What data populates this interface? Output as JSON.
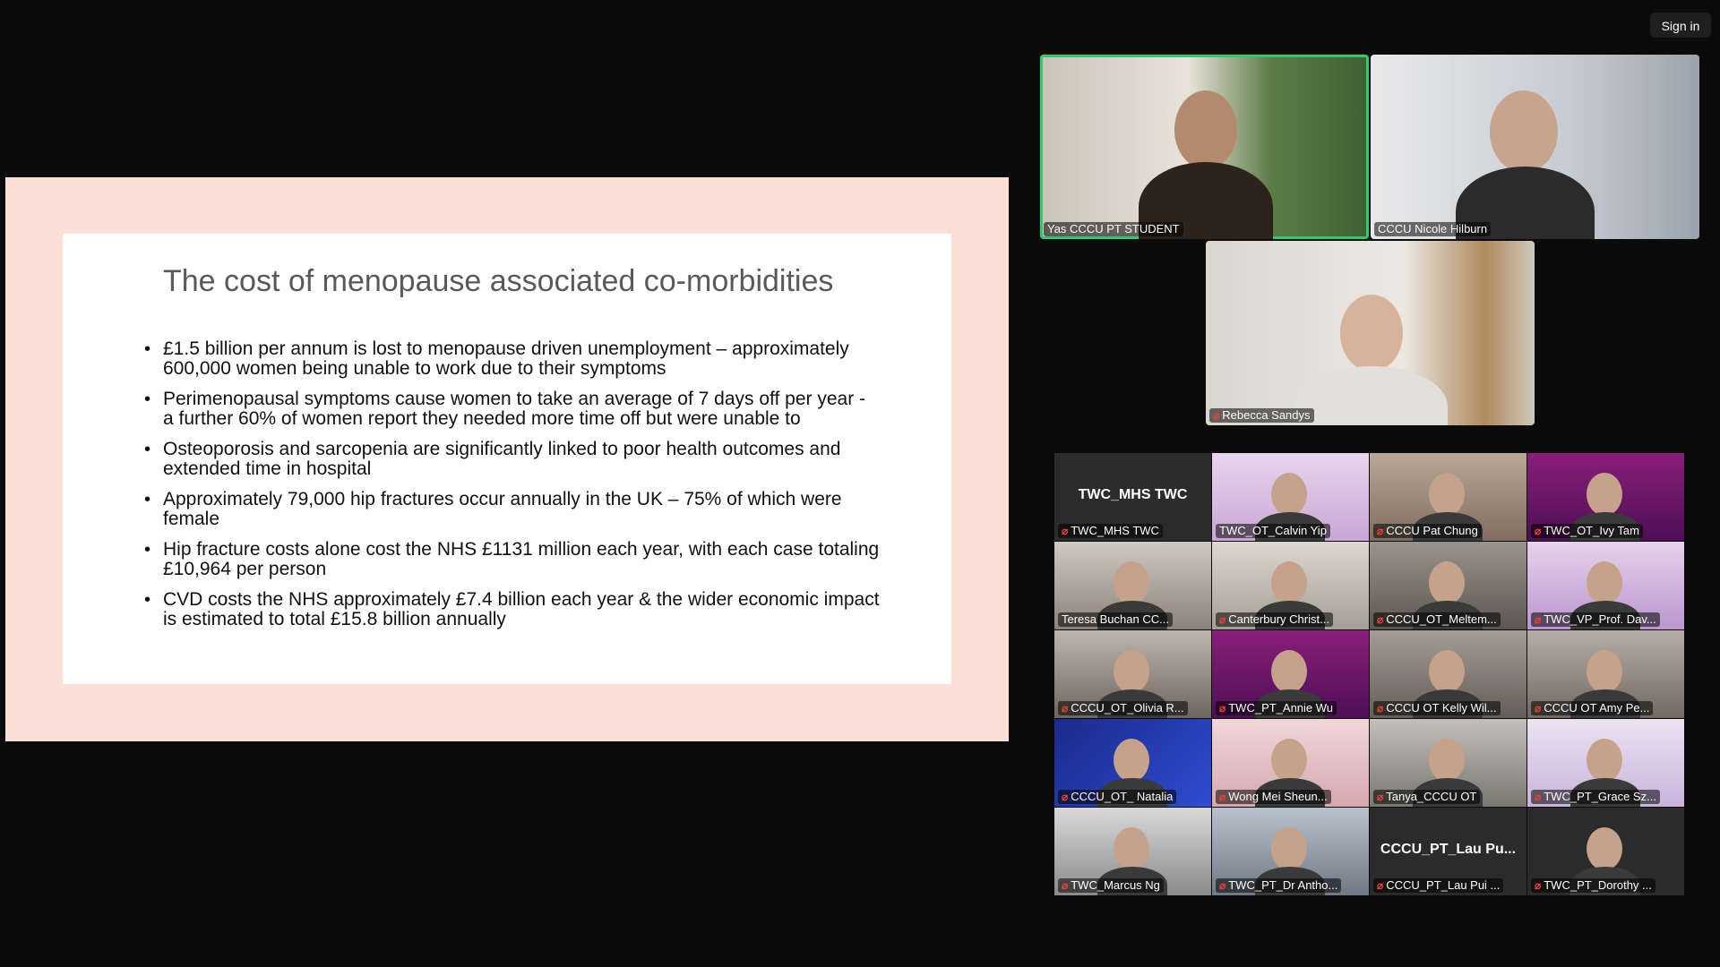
{
  "topbar": {
    "signin_label": "Sign in"
  },
  "slide": {
    "title": "The cost of menopause associated co-morbidities",
    "bullets": [
      "£1.5 billion per annum is lost to menopause driven unemployment – approximately 600,000 women being unable to work due to their symptoms",
      "Perimenopausal symptoms cause women to take an average of 7 days off per year - a further 60% of women report they needed more time off but were unable to",
      "Osteoporosis and sarcopenia are significantly linked to poor health outcomes and extended time in hospital",
      "Approximately 79,000 hip fractures occur annually in the UK – 75% of which were female",
      "Hip fracture costs alone cost the NHS £1131 million each year, with each case totaling £10,964 per person",
      "CVD costs the NHS approximately £7.4 billion each year &  the wider economic impact is estimated to total £15.8 billion annually"
    ]
  },
  "spotlight": [
    {
      "name": "Yas CCCU PT STUDENT",
      "muted": false,
      "speaking": true
    },
    {
      "name": "CCCU Nicole Hilburn",
      "muted": false,
      "speaking": false
    },
    {
      "name": "Rebecca Sandys",
      "muted": true,
      "speaking": false
    }
  ],
  "gallery": [
    {
      "name": "TWC_MHS TWC",
      "muted": true,
      "center_label": "TWC_MHS TWC"
    },
    {
      "name": "TWC_OT_Calvin Yip",
      "muted": false,
      "center_label": ""
    },
    {
      "name": "CCCU Pat Chung",
      "muted": true,
      "center_label": ""
    },
    {
      "name": "TWC_OT_Ivy Tam",
      "muted": true,
      "center_label": ""
    },
    {
      "name": "Teresa Buchan CC...",
      "muted": false,
      "center_label": ""
    },
    {
      "name": "Canterbury Christ...",
      "muted": true,
      "center_label": ""
    },
    {
      "name": "CCCU_OT_Meltem...",
      "muted": true,
      "center_label": ""
    },
    {
      "name": "TWC_VP_Prof. Dav...",
      "muted": true,
      "center_label": ""
    },
    {
      "name": "CCCU_OT_Olivia R...",
      "muted": true,
      "center_label": ""
    },
    {
      "name": "TWC_PT_Annie Wu",
      "muted": true,
      "center_label": ""
    },
    {
      "name": "CCCU OT Kelly Wil...",
      "muted": true,
      "center_label": ""
    },
    {
      "name": "CCCU OT Amy Pe...",
      "muted": true,
      "center_label": ""
    },
    {
      "name": "CCCU_OT_ Natalia",
      "muted": true,
      "center_label": ""
    },
    {
      "name": "Wong Mei Sheun...",
      "muted": true,
      "center_label": ""
    },
    {
      "name": "Tanya_CCCU OT",
      "muted": true,
      "center_label": ""
    },
    {
      "name": "TWC_PT_Grace Sz...",
      "muted": true,
      "center_label": ""
    },
    {
      "name": "TWC_Marcus Ng",
      "muted": true,
      "center_label": ""
    },
    {
      "name": "TWC_PT_Dr Antho...",
      "muted": true,
      "center_label": ""
    },
    {
      "name": "CCCU_PT_Lau Pui ...",
      "muted": true,
      "center_label": "CCCU_PT_Lau  Pu..."
    },
    {
      "name": "TWC_PT_Dorothy ...",
      "muted": true,
      "center_label": ""
    }
  ],
  "mic_muted_icon": "microphone-muted-icon",
  "colors": {
    "speaking_outline": "#2ecc71",
    "muted_icon": "#e8432f",
    "slide_frame": "#f9dfd6"
  }
}
